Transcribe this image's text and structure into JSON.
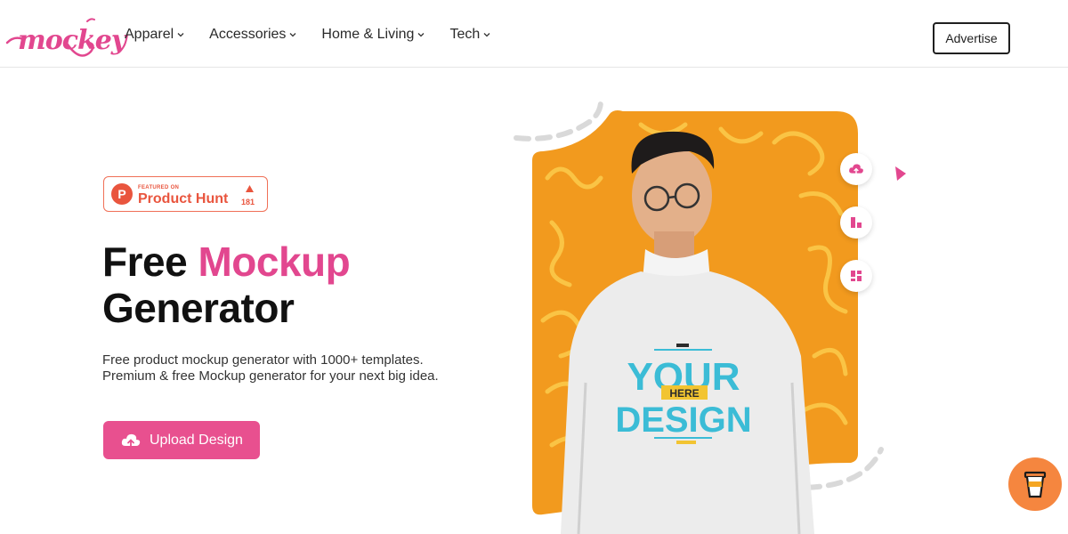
{
  "header": {
    "logo_text": "mockey",
    "nav": [
      {
        "label": "Apparel"
      },
      {
        "label": "Accessories"
      },
      {
        "label": "Home & Living"
      },
      {
        "label": "Tech"
      }
    ],
    "advertise_label": "Advertise"
  },
  "badge": {
    "featured_on": "FEATURED ON",
    "name": "Product Hunt",
    "count": "181"
  },
  "hero": {
    "title_word1": "Free",
    "title_word2": "Mockup",
    "title_line2": "Generator",
    "description": "Free product mockup generator with 1000+ templates. Premium & free Mockup generator for your next big idea.",
    "upload_label": "Upload Design"
  },
  "shirt_print": {
    "line1": "YOUR",
    "line2": "HERE",
    "line3": "DESIGN"
  },
  "colors": {
    "brand_pink": "#e2478f",
    "producthunt_orange": "#e9553e",
    "art_orange": "#f29a1e",
    "cup_orange": "#f5863f"
  },
  "icons": [
    "chevron-down-icon",
    "upload-cloud-icon",
    "layout-icon",
    "grid-icon",
    "cursor-arrow-icon",
    "coffee-cup-icon"
  ]
}
